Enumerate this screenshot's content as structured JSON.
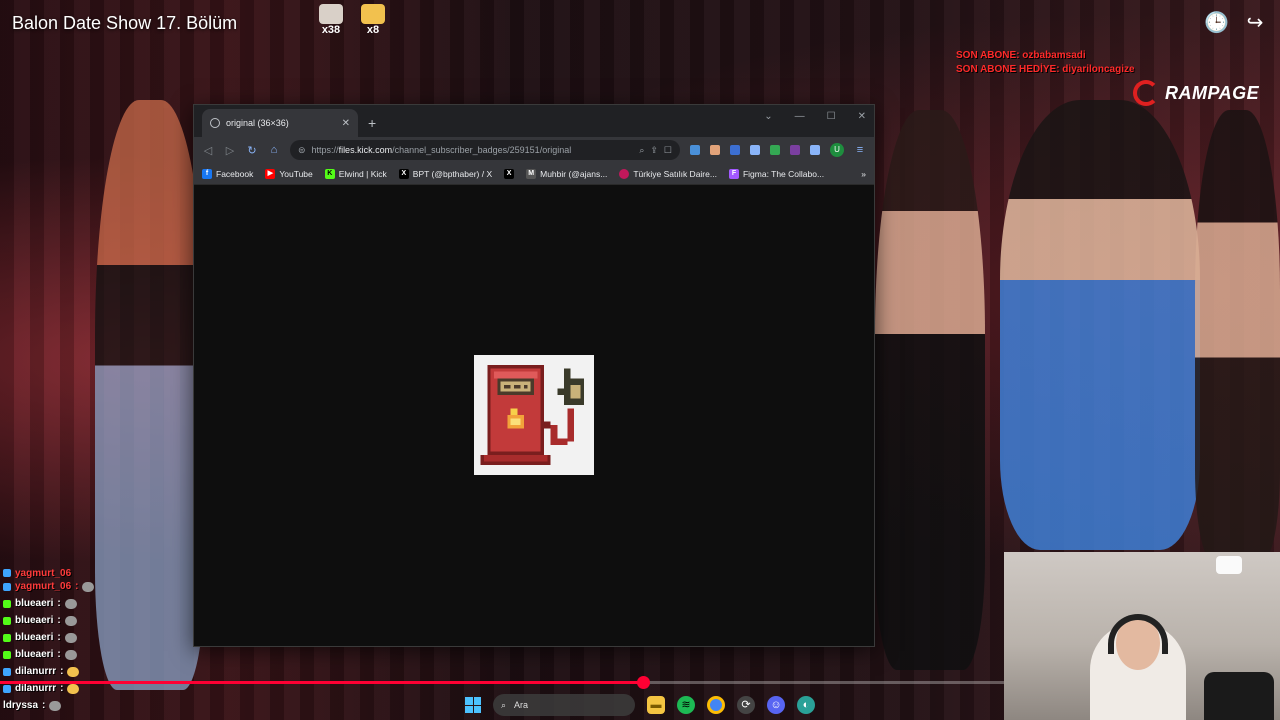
{
  "video": {
    "title": "Balon Date Show 17. Bölüm",
    "gifts": [
      {
        "count": "x38",
        "color": "#d9d0c8"
      },
      {
        "count": "x8",
        "color": "#f2c14e"
      }
    ],
    "overlay_lines": [
      "SON ABONE: ozbabamsadi",
      "SON ABONE HEDİYE: diyariloncagize"
    ],
    "brand": "RAMPAGE",
    "progress": 0.64,
    "accent": "#ff0033"
  },
  "browser": {
    "tab_title": "original (36×36)",
    "url_prefix": "https://",
    "url_host": "files.kick.com",
    "url_path": "/channel_subscriber_badges/259151/original",
    "profile_initial": "U",
    "bookmarks": [
      {
        "label": "Facebook",
        "icon": "facebook-icon",
        "color": "#1877f2",
        "glyph": "f"
      },
      {
        "label": "YouTube",
        "icon": "youtube-icon",
        "color": "#ff0000",
        "glyph": "▶"
      },
      {
        "label": "Elwind | Kick",
        "icon": "kick-icon",
        "color": "#53fc18",
        "glyph": "K"
      },
      {
        "label": "BPT (@bpthaber) / X",
        "icon": "x-icon",
        "color": "#000000",
        "glyph": "X"
      },
      {
        "label": "",
        "icon": "x-icon",
        "color": "#000000",
        "glyph": "X"
      },
      {
        "label": "Muhbir (@ajans...",
        "icon": "muhbir-icon",
        "color": "#555555",
        "glyph": "M"
      },
      {
        "label": "Türkiye Satılık Daire...",
        "icon": "sahibinden-icon",
        "color": "#c2185b",
        "glyph": "●"
      },
      {
        "label": "Figma: The Collabo...",
        "icon": "figma-icon",
        "color": "#a259ff",
        "glyph": "F"
      }
    ]
  },
  "chat": [
    {
      "user": "yagmurt_06",
      "msg": "",
      "color": "#ff3b3b",
      "badge": "#3ea6ff"
    },
    {
      "user": "yagmurt_06",
      "msg": ":",
      "color": "#ff3b3b",
      "badge": "#3ea6ff"
    },
    {
      "user": "blueaeri",
      "msg": ":",
      "color": "#ffffff",
      "badge": "#53fc18"
    },
    {
      "user": "blueaeri",
      "msg": ":",
      "color": "#ffffff",
      "badge": "#53fc18"
    },
    {
      "user": "blueaeri",
      "msg": ":",
      "color": "#ffffff",
      "badge": "#53fc18"
    },
    {
      "user": "blueaeri",
      "msg": ":",
      "color": "#ffffff",
      "badge": "#53fc18"
    },
    {
      "user": "dilanurrr",
      "msg": ":",
      "color": "#ffffff",
      "badge": "#3ea6ff"
    },
    {
      "user": "dilanurrr",
      "msg": ":",
      "color": "#ffffff",
      "badge": "#3ea6ff"
    },
    {
      "user": "ldryssa",
      "msg": ":",
      "color": "#ffffff",
      "badge": ""
    }
  ],
  "taskbar": {
    "search_placeholder": "Ara"
  }
}
